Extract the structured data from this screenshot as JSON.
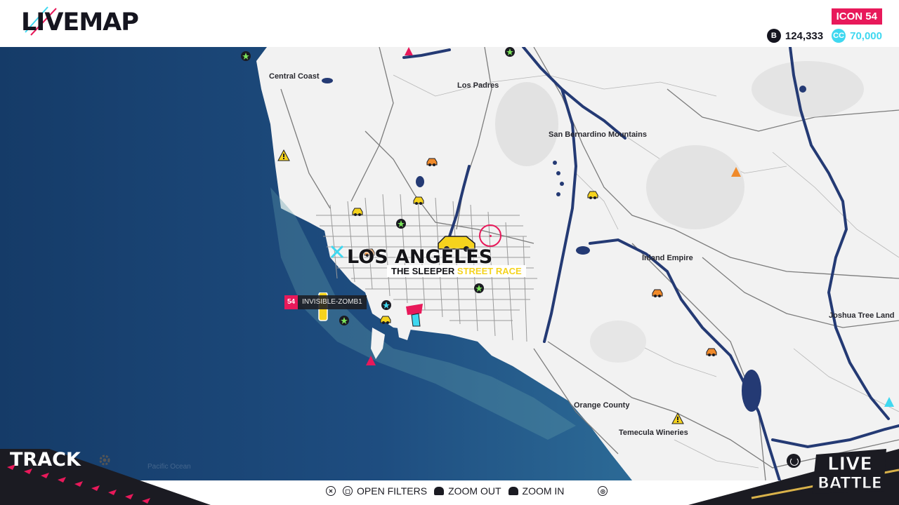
{
  "header": {
    "title": "LIVEMAP",
    "rank_badge": "ICON 54",
    "bucks": "124,333",
    "bucks_icon": "bucks-coin-icon",
    "crew_credits": "70,000",
    "crew_credits_icon_text": "CC",
    "colors": {
      "accent": "#e8195a",
      "cc": "#3fd8f0",
      "ink": "#15151f"
    }
  },
  "map": {
    "regions": [
      "Central Coast",
      "Los Padres",
      "San Bernardino Mountains",
      "Inland Empire",
      "Joshua Tree Land",
      "Orange County",
      "Temecula Wineries"
    ],
    "ocean_label": "Pacific Ocean",
    "city": "LOS ANGELES",
    "event": {
      "name": "THE SLEEPER",
      "type": "STREET RACE"
    },
    "player": {
      "level": "54",
      "name": "INVISIBLE-ZOMB1"
    },
    "colors": {
      "ocean": "#1d4a7c",
      "land": "#f1f1f1",
      "river": "#24346e",
      "road": "#8a8a8a"
    }
  },
  "bottom": {
    "track_label": "TRACK",
    "live_badge_line1": "LIVE",
    "live_badge_line2": "BATTLE",
    "hints": [
      {
        "glyph": "✕",
        "label": ""
      },
      {
        "glyph": "▢",
        "label": "OPEN FILTERS"
      },
      {
        "glyph": "L1",
        "label": "ZOOM OUT"
      },
      {
        "glyph": "R1",
        "label": "ZOOM IN"
      },
      {
        "glyph": "◎",
        "label": ""
      }
    ]
  }
}
